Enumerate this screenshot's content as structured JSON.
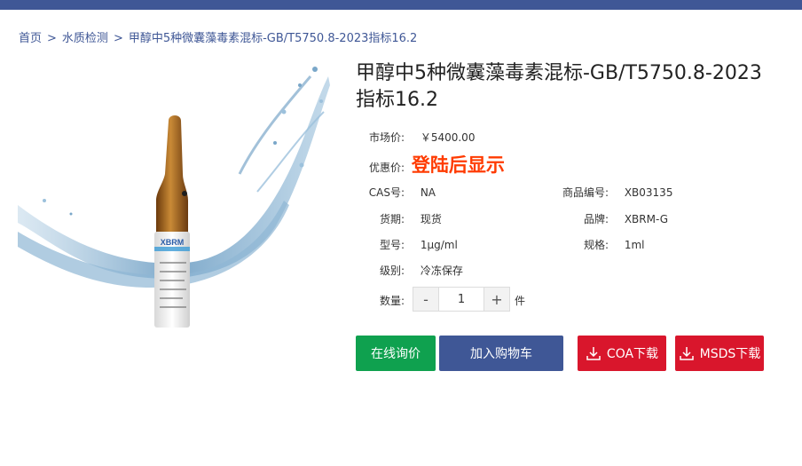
{
  "breadcrumb": {
    "home": "首页",
    "separator": ">",
    "category": "水质检测",
    "current": "甲醇中5种微囊藻毒素混标-GB/T5750.8-2023指标16.2"
  },
  "product": {
    "title": "甲醇中5种微囊藻毒素混标-GB/T5750.8-2023指标16.2",
    "image_label": "XBRM",
    "market_price_label": "市场价:",
    "market_price_value": "￥5400.00",
    "discount_label": "优惠价:",
    "discount_value": "登陆后显示",
    "cas_label": "CAS号:",
    "cas_value": "NA",
    "code_label": "商品编号:",
    "code_value": "XB03135",
    "stock_label": "货期:",
    "stock_value": "现货",
    "brand_label": "品牌:",
    "brand_value": "XBRM-G",
    "model_label": "型号:",
    "model_value": "1μg/ml",
    "spec_label": "规格:",
    "spec_value": "1ml",
    "storage_label": "级别:",
    "storage_value": "冷冻保存",
    "qty_label": "数量:",
    "qty_value": "1",
    "qty_minus": "-",
    "qty_plus": "+",
    "qty_unit": "件"
  },
  "actions": {
    "inquiry": "在线询价",
    "cart": "加入购物车",
    "coa": "COA下载",
    "msds": "MSDS下载"
  },
  "icons": {
    "coa": "download-icon",
    "msds": "download-icon"
  },
  "colors": {
    "brand_blue": "#3f5796",
    "green": "#0fa14f",
    "red": "#d9162c",
    "price_highlight": "#ff3b00"
  }
}
